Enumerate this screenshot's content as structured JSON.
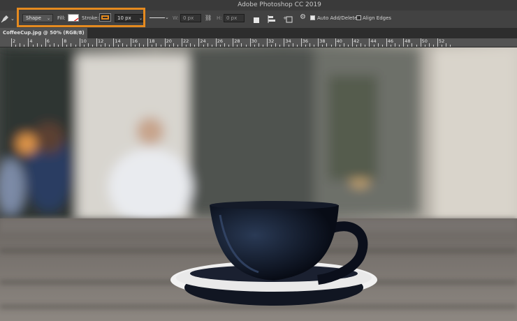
{
  "app": {
    "title": "Adobe Photoshop CC 2019"
  },
  "options_bar": {
    "mode_value": "Shape",
    "fill_label": "Fill:",
    "stroke_label": "Stroke:",
    "stroke_width_value": "10 px",
    "w_label": "W:",
    "w_value": "0 px",
    "h_label": "H:",
    "h_value": "0 px",
    "auto_add_delete_label": "Auto Add/Delete",
    "auto_add_delete_checked": true,
    "align_edges_label": "Align Edges",
    "align_edges_checked": false,
    "highlight_color": "#e58a1f",
    "stroke_color": "#e58a1f",
    "tool_icon": "pen-icon"
  },
  "document": {
    "tab_label": "CoffeeCup.jpg @ 50% (RGB/8)"
  },
  "ruler": {
    "labels": [
      "2",
      "4",
      "6",
      "8",
      "10",
      "12",
      "14",
      "16",
      "18",
      "20",
      "22",
      "24",
      "26",
      "28",
      "30",
      "32",
      "34",
      "36",
      "38",
      "40",
      "42",
      "44",
      "46",
      "48",
      "50",
      "52"
    ]
  }
}
